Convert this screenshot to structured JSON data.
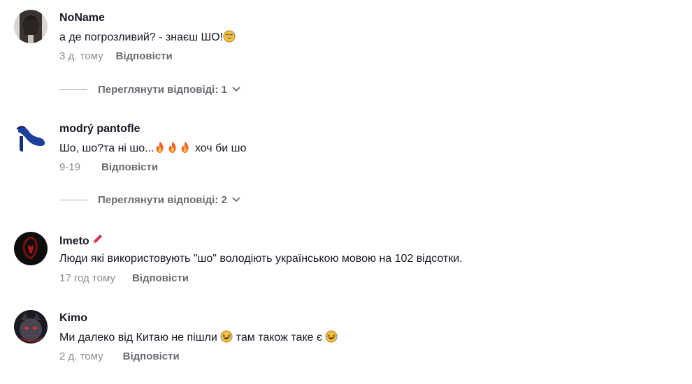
{
  "comments": [
    {
      "username": "NoName",
      "text": "а де погрозливий? - знаєш ШО!",
      "text_emoji": "grinning-sweat-emoji",
      "time": "3 д. тому",
      "reply_label": "Відповісти",
      "view_replies": "Переглянути відповіді: 1"
    },
    {
      "username": "modrý pantofle",
      "text": "Шо, шо?та ні шо...",
      "text_emoji": "fire-emoji",
      "text_after": "хоч би шо",
      "time": "9-19",
      "reply_label": "Відповісти",
      "view_replies": "Переглянути відповіді: 2"
    },
    {
      "username": "lmeto",
      "name_icon": "pencil-icon",
      "text": "Люди які використовують \"шо\" володіють українською мовою на 102 відсотки.",
      "time": "17 год тому",
      "reply_label": "Відповісти"
    },
    {
      "username": "Kimo",
      "text": "Ми далеко від Китаю не пішли",
      "text_emoji": "rofl-emoji",
      "text_after": "там також таке є",
      "time": "2 д. тому",
      "reply_label": "Відповісти"
    }
  ],
  "colors": {
    "text": "#161823",
    "muted": "#8a8b91",
    "reply": "#6b6c73"
  }
}
